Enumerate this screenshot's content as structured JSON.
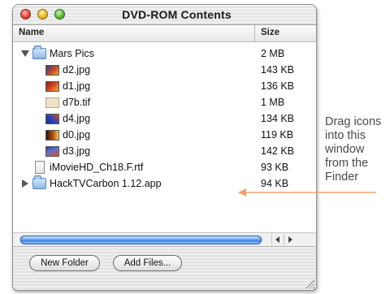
{
  "window": {
    "title": "DVD-ROM Contents"
  },
  "columns": {
    "name": "Name",
    "size": "Size"
  },
  "files": [
    {
      "name": "Mars Pics",
      "size": "2 MB",
      "kind": "folder",
      "disclosure": "open",
      "icon": "folder-icon"
    },
    {
      "name": "d2.jpg",
      "size": "143 KB",
      "kind": "image",
      "icon": "image-thumbnail-icon"
    },
    {
      "name": "d1.jpg",
      "size": "136 KB",
      "kind": "image",
      "icon": "image-thumbnail-icon"
    },
    {
      "name": "d7b.tif",
      "size": "1 MB",
      "kind": "image",
      "icon": "image-thumbnail-icon"
    },
    {
      "name": "d4.jpg",
      "size": "134 KB",
      "kind": "image",
      "icon": "image-thumbnail-icon"
    },
    {
      "name": "d0.jpg",
      "size": "119 KB",
      "kind": "image",
      "icon": "image-thumbnail-icon"
    },
    {
      "name": "d3.jpg",
      "size": "142 KB",
      "kind": "image",
      "icon": "image-thumbnail-icon"
    },
    {
      "name": "iMovieHD_Ch18.F.rtf",
      "size": "93 KB",
      "kind": "document",
      "icon": "document-icon"
    },
    {
      "name": "HackTVCarbon 1.12.app",
      "size": "94 KB",
      "kind": "folder",
      "disclosure": "closed",
      "icon": "folder-icon"
    }
  ],
  "buttons": {
    "new_folder": "New Folder",
    "add_files": "Add Files..."
  },
  "callout": {
    "lines": [
      "Drag icons",
      "into this",
      "window",
      "from the",
      "Finder"
    ]
  },
  "colors": {
    "arrow": "#f0a070",
    "scroll_thumb": "#3d7fe0"
  }
}
